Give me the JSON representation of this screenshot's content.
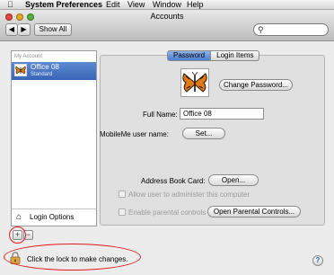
{
  "menubar": {
    "app": "System Preferences",
    "items": [
      "Edit",
      "View",
      "Window",
      "Help"
    ]
  },
  "window": {
    "title": "Accounts",
    "show_all": "Show All",
    "search_placeholder": ""
  },
  "sidebar": {
    "section_label": "My Account",
    "account_name": "Office 08",
    "account_role": "Standard",
    "login_options": "Login Options"
  },
  "tabs": {
    "password": "Password",
    "login_items": "Login Items",
    "selected": "Password"
  },
  "form": {
    "change_password": "Change Password...",
    "full_name_label": "Full Name:",
    "full_name_value": "Office 08",
    "mobileme_label": "MobileMe user name:",
    "set_button": "Set...",
    "address_book_label": "Address Book Card:",
    "open_button": "Open...",
    "allow_admin": "Allow user to administer this computer",
    "parental_controls": "Enable parental controls",
    "open_parental": "Open Parental Controls..."
  },
  "bottom": {
    "add": "+",
    "remove": "−",
    "lock_message": "Click the lock to make changes.",
    "help": "?"
  },
  "colors": {
    "selection": "#3f6dbe",
    "annotation_ring": "#e0191f"
  }
}
